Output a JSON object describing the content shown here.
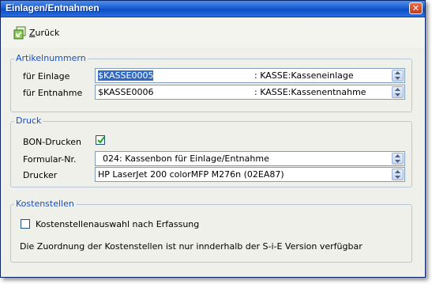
{
  "window": {
    "title": "Einlagen/Entnahmen",
    "close_label": "✕"
  },
  "toolbar": {
    "back_label": "Zurück"
  },
  "artikelnummern": {
    "legend": "Artikelnummern",
    "einlage_label": "für Einlage",
    "einlage_value": "$KASSE0005",
    "einlage_desc": ": KASSE:Kasseneinlage",
    "entnahme_label": "für Entnahme",
    "entnahme_value": "$KASSE0006",
    "entnahme_desc": ": KASSE:Kassenentnahme"
  },
  "druck": {
    "legend": "Druck",
    "bon_label": "BON-Drucken",
    "bon_checked": true,
    "formular_label": "Formular-Nr.",
    "formular_value": "024: Kassenbon für Einlage/Entnahme",
    "drucker_label": "Drucker",
    "drucker_value": "HP LaserJet 200 colorMFP M276n (02EA87)"
  },
  "kostenstellen": {
    "legend": "Kostenstellen",
    "auswahl_label": "Kostenstellenauswahl nach Erfassung",
    "auswahl_checked": false,
    "info_text": "Die Zuordnung der Kostenstellen ist nur innderhalb der S-i-E Version verfügbar"
  },
  "colors": {
    "titlebar": "#0d4ec6",
    "legend": "#1a4fb8",
    "selection": "#316ac5"
  }
}
